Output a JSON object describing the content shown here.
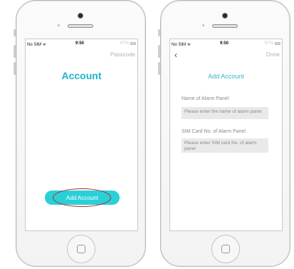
{
  "left_phone": {
    "status": {
      "carrier": "No SIM ᯤ",
      "time": "9:50",
      "battery": "97%"
    },
    "nav_right": "Passcode",
    "title": "Account",
    "add_button": "Add Account"
  },
  "right_phone": {
    "status": {
      "carrier": "No SIM ᯤ",
      "time": "9:50",
      "battery": "97%"
    },
    "back_icon": "‹",
    "nav_right": "Done",
    "title": "Add Account",
    "fields": [
      {
        "label": "Name of Alarm Panel",
        "placeholder": "Please enter the name of alarm panel"
      },
      {
        "label": "SIM Card No. of Alarm Panel",
        "placeholder": "Please enter SIM card No. of alarm panel"
      }
    ]
  },
  "colors": {
    "accent": "#2ad0d8",
    "title": "#1fb5c8",
    "highlight": "#b4262a"
  },
  "icons": [
    "back-chevron-icon",
    "wifi-icon",
    "battery-icon",
    "camera-icon",
    "speaker-icon",
    "home-button-icon"
  ]
}
